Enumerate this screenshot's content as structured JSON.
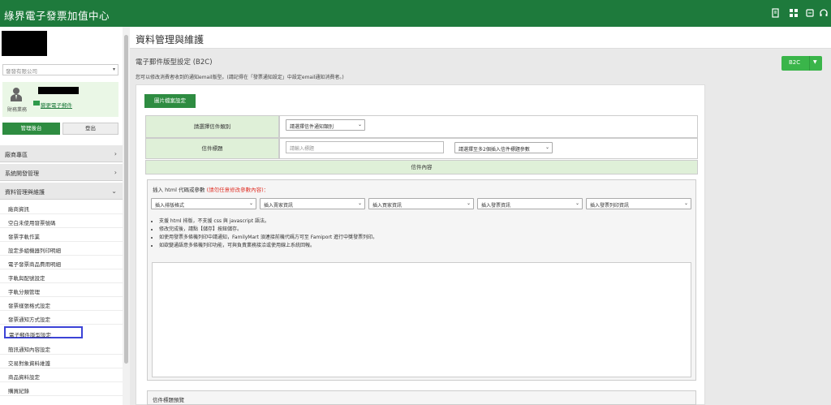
{
  "app": {
    "title": "綠界電子發票加值中心"
  },
  "sidebar": {
    "company_select": "發發有限公司",
    "user": {
      "role": "財務業務",
      "mail_link": "變更電子郵件"
    },
    "admin_button": "管理後台",
    "logout_button": "登出",
    "groups": [
      {
        "label": "廠商專區"
      },
      {
        "label": "系統開發管理"
      },
      {
        "label": "資料管理與維護"
      }
    ],
    "items": [
      {
        "label": "廠商資訊"
      },
      {
        "label": "空白未使用發票號碼"
      },
      {
        "label": "發票字軌作業"
      },
      {
        "label": "設定多組機器列印明細"
      },
      {
        "label": "電子發票商品費用明細"
      },
      {
        "label": "字軌與配號設定"
      },
      {
        "label": "字軌分類管理"
      },
      {
        "label": "發票樣張格式設定"
      },
      {
        "label": "發票通知方式設定"
      },
      {
        "label": "電子郵件版型設定"
      },
      {
        "label": "簡訊通知內容設定"
      },
      {
        "label": "交易對象資料維護"
      },
      {
        "label": "商品資料設定"
      },
      {
        "label": "購買紀錄"
      }
    ]
  },
  "header": {
    "title": "資料管理與維護"
  },
  "main": {
    "title": "電子郵件版型設定 (B2C)",
    "description": "您可以修改消費者收到的通知email版型。(請記得在「發票通知設定」中設定email通知消費者。)",
    "b2c_button": "B2C",
    "image_button": "圖片檔案設定",
    "form": {
      "type_label": "請選擇信件類別",
      "type_select": "請選擇信件通知類別",
      "subject_label": "信件標題",
      "subject_placeholder": "請輸入標題",
      "subject_param_select": "請選擇至多2個插入信件標題參數",
      "content_header": "信件內容",
      "editor_label": "插入 html 代碼或參數",
      "editor_warning": "(請勿任意修改參數內容)：",
      "insert_selects": [
        "插入排版格式",
        "插入賣家資訊",
        "插入買家資訊",
        "插入發票資訊",
        "插入發票列印資訊"
      ],
      "notes": [
        "支援 html 排版，不支援 css 與 javascript 語法。",
        "修改完成後，請點【儲存】按鈕儲存。",
        "如使用發票多條機列印中請通知，FamilyMart 須連接前機代碼方可至 Famiport 進行中獎發票列印。",
        "如欲變通語意多條機列印功能，可與負責業務接洽或使用線上系統回報。"
      ],
      "preview_label": "信件標題預覽"
    }
  }
}
